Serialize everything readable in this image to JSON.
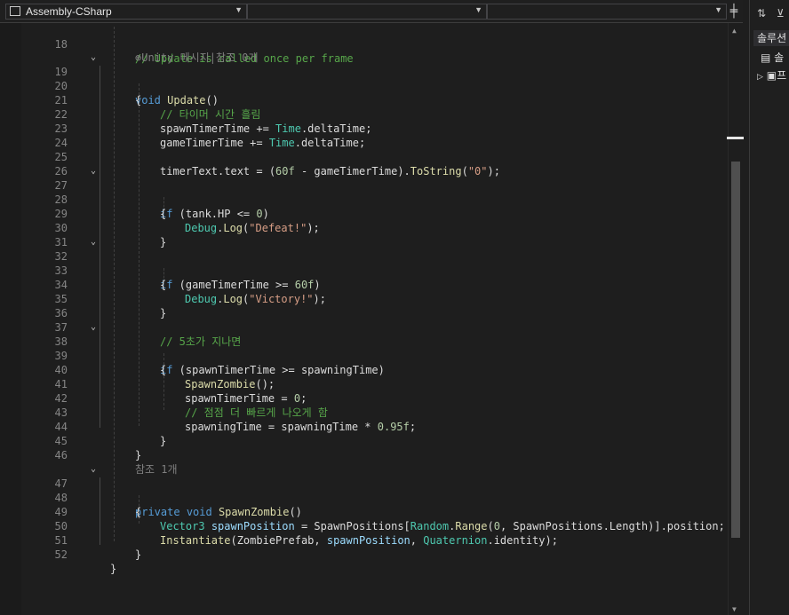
{
  "nav": {
    "project_combo": "Assembly-CSharp",
    "class_combo": "",
    "member_combo": ""
  },
  "solution_explorer": {
    "title": "솔루션",
    "items": [
      "솔",
      "프"
    ]
  },
  "code": {
    "l18": {
      "num": "18",
      "comment": "// Update is called once per frame"
    },
    "l18hint": {
      "text": "Unity 메시지|참조 0개"
    },
    "l19": {
      "num": "19",
      "kw": "void",
      "name": "Update",
      "paren": "()"
    },
    "l20": {
      "num": "20",
      "text": "{"
    },
    "l21": {
      "num": "21",
      "comment": "// 타이머 시간 흘림"
    },
    "l22": {
      "num": "22",
      "a": "spawnTimerTime += ",
      "type": "Time",
      "b": ".deltaTime;"
    },
    "l23": {
      "num": "23",
      "a": "gameTimerTime += ",
      "type": "Time",
      "b": ".deltaTime;"
    },
    "l24": {
      "num": "24"
    },
    "l25": {
      "num": "25",
      "a": "timerText.text = (",
      "n": "60f",
      "b": " - gameTimerTime).",
      "m": "ToString",
      "c": "(",
      "s": "\"0\"",
      "d": ");"
    },
    "l26": {
      "num": "26"
    },
    "l27": {
      "num": "27",
      "kw": "if",
      "a": " (tank.HP <= ",
      "n": "0",
      "b": ")"
    },
    "l28": {
      "num": "28",
      "text": "{"
    },
    "l29": {
      "num": "29",
      "type": "Debug",
      "dot": ".",
      "m": "Log",
      "a": "(",
      "s": "\"Defeat!\"",
      "b": ");"
    },
    "l30": {
      "num": "30",
      "text": "}"
    },
    "l31": {
      "num": "31"
    },
    "l32": {
      "num": "32",
      "kw": "if",
      "a": " (gameTimerTime >= ",
      "n": "60f",
      "b": ")"
    },
    "l33": {
      "num": "33",
      "text": "{"
    },
    "l34": {
      "num": "34",
      "type": "Debug",
      "dot": ".",
      "m": "Log",
      "a": "(",
      "s": "\"Victory!\"",
      "b": ");"
    },
    "l35": {
      "num": "35",
      "text": "}"
    },
    "l36": {
      "num": "36"
    },
    "l37": {
      "num": "37",
      "comment": "// 5초가 지나면"
    },
    "l38": {
      "num": "38",
      "kw": "if",
      "a": " (spawnTimerTime >= spawningTime)"
    },
    "l39": {
      "num": "39",
      "text": "{"
    },
    "l40": {
      "num": "40",
      "m": "SpawnZombie",
      "a": "();"
    },
    "l41": {
      "num": "41",
      "a": "spawnTimerTime = ",
      "n": "0",
      "b": ";"
    },
    "l42": {
      "num": "42",
      "comment": "// 점점 더 빠르게 나오게 함"
    },
    "l43": {
      "num": "43",
      "a": "spawningTime = spawningTime * ",
      "n": "0.95f",
      "b": ";"
    },
    "l44": {
      "num": "44",
      "text": "}"
    },
    "l45": {
      "num": "45",
      "text": "}"
    },
    "l46": {
      "num": "46"
    },
    "l46hint": {
      "text": "참조 1개"
    },
    "l47": {
      "num": "47",
      "kw1": "private",
      "kw2": "void",
      "m": "SpawnZombie",
      "a": "()"
    },
    "l48": {
      "num": "48",
      "text": "{"
    },
    "l49": {
      "num": "49",
      "type": "Vector3",
      "var": "spawnPosition",
      "a": " = SpawnPositions[",
      "type2": "Random",
      "dot": ".",
      "m": "Range",
      "b": "(",
      "n": "0",
      "c": ", SpawnPositions.Length)].position;"
    },
    "l50": {
      "num": "50",
      "m": "Instantiate",
      "a": "(ZombiePrefab, ",
      "var": "spawnPosition",
      "b": ", ",
      "type": "Quaternion",
      "c": ".identity);"
    },
    "l51": {
      "num": "51",
      "text": "}"
    },
    "l52": {
      "num": "52",
      "text": "}"
    }
  }
}
